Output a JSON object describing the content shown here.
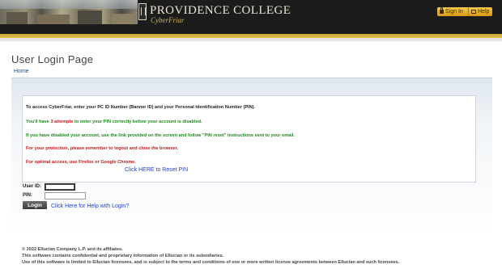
{
  "header": {
    "college_name": "PROVIDENCE COLLEGE",
    "subtitle": "CyberFriar",
    "sign_in_label": "Sign In",
    "help_label": "Help"
  },
  "page": {
    "title": "User Login Page",
    "breadcrumb_home": "Home"
  },
  "messages": {
    "intro": "To access CyberFriar, enter your PC ID Number (Banner ID) and your Personal Identification Number (PIN).",
    "attempts_pre": "You'll have ",
    "attempts_count": "3 attempts",
    "attempts_post": " to enter your PIN correctly before your account is disabled.",
    "disabled": "If you have disabled your account, use the link provided on the screen and follow \"PIN reset\" instructions sent to your email.",
    "logout": "For your protection, please remember to logout and close the browser.",
    "browser": "For optimal access, use Firefox or Google Chrome.",
    "reset_link": "Click HERE to Reset PIN"
  },
  "form": {
    "user_id_label": "User ID:",
    "user_id_value": "",
    "pin_label": "PIN:",
    "pin_value": "",
    "login_button": "Login",
    "help_link": "Click Here for Help with Login?"
  },
  "footer": {
    "line1": "© 2022 Ellucian Company L.P. and its affiliates.",
    "line2": "This software contains confidential and proprietary information of Ellucian or its subsidiaries.",
    "line3": "Use of this software is limited to Ellucian licensees, and is subject to the terms and conditions of one or more written license agreements between Ellucian and such licensees."
  },
  "colors": {
    "gold_accent": "#e2bd52",
    "header_dark": "#1c1c1c",
    "link_blue": "#1f3fd6",
    "warning_green": "#1b8a1b",
    "warning_red": "#d01515"
  }
}
